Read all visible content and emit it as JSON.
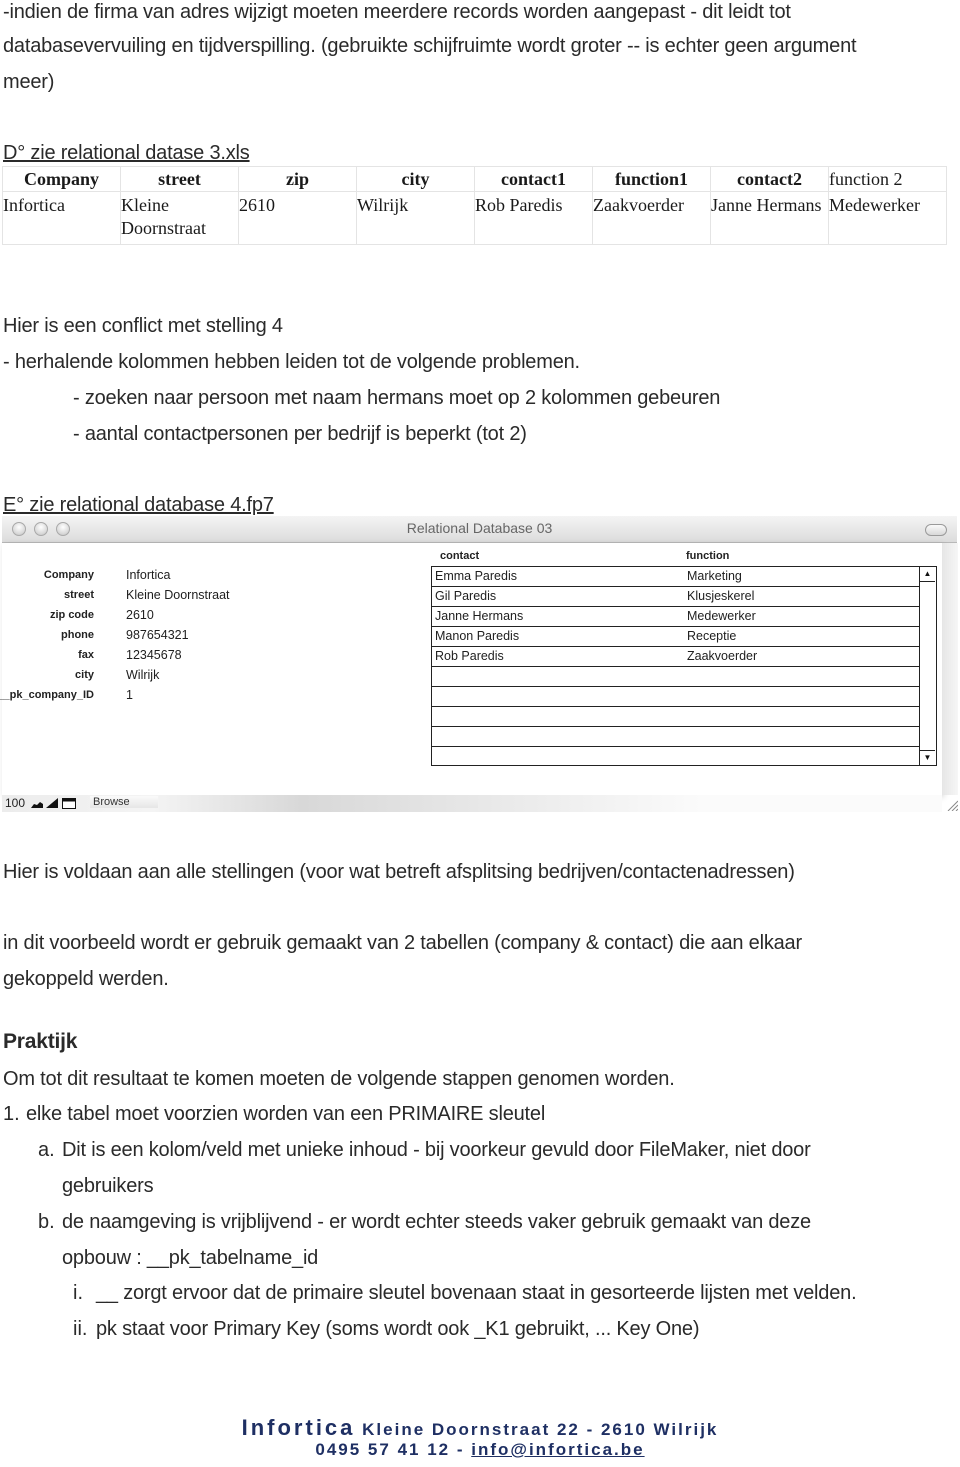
{
  "intro": {
    "line1": "-indien de firma van adres wijzigt moeten meerdere records worden aangepast - dit leidt tot",
    "line2": "databasevervuiling en tijdverspilling. (gebruikte schijfruimte wordt groter -- is echter geen argument",
    "line3": "meer)"
  },
  "section_d": {
    "heading": "D° zie relational datase 3.xls",
    "table": {
      "headers": [
        "Company",
        "street",
        "zip",
        "city",
        "contact1",
        "function1",
        "contact2",
        "function 2"
      ],
      "rows": [
        [
          "Infortica",
          "Kleine Doornstraat",
          "2610",
          "Wilrijk",
          "Rob Paredis",
          "Zaakvoerder",
          "Janne Hermans",
          "Medewerker"
        ]
      ]
    }
  },
  "conflict": {
    "line1": "Hier is een conflict met stelling 4",
    "line2": "- herhalende kolommen hebben leiden tot de volgende problemen.",
    "bullet1": "- zoeken naar persoon met naam hermans moet op 2 kolommen gebeuren",
    "bullet2": "- aantal contactpersonen per bedrijf is beperkt (tot 2)"
  },
  "section_e": {
    "heading": "E° zie relational database 4.fp7"
  },
  "window": {
    "title": "Relational Database 03",
    "fields": [
      {
        "label": "Company",
        "value": "Infortica"
      },
      {
        "label": "street",
        "value": "Kleine Doornstraat"
      },
      {
        "label": "zip code",
        "value": "2610"
      },
      {
        "label": "phone",
        "value": "987654321"
      },
      {
        "label": "fax",
        "value": "12345678"
      },
      {
        "label": "city",
        "value": "Wilrijk"
      },
      {
        "label": "__pk_company_ID",
        "value": "1"
      }
    ],
    "portal": {
      "headers": {
        "contact": "contact",
        "function": "function"
      },
      "rows": [
        {
          "contact": "Emma Paredis",
          "function": "Marketing"
        },
        {
          "contact": "Gil Paredis",
          "function": "Klusjeskerel"
        },
        {
          "contact": "Janne Hermans",
          "function": "Medewerker"
        },
        {
          "contact": "Manon Paredis",
          "function": "Receptie"
        },
        {
          "contact": "Rob Paredis",
          "function": "Zaakvoerder"
        }
      ],
      "scroll_up_icon": "▲",
      "scroll_down_icon": "▼"
    },
    "statusbar": {
      "zoom": "100",
      "mode": "Browse"
    }
  },
  "result": {
    "line1": "Hier is voldaan aan alle stellingen (voor wat betreft afsplitsing bedrijven/contactenadressen)",
    "line2": "in dit voorbeeld wordt er gebruik gemaakt van 2 tabellen (company & contact) die aan elkaar",
    "line3": "gekoppeld werden."
  },
  "praktijk": {
    "heading": "Praktijk",
    "intro": "Om tot dit resultaat te komen moeten de volgende stappen genomen worden.",
    "items": {
      "n1": {
        "marker": "1.",
        "text": "elke tabel moet voorzien worden van een PRIMAIRE sleutel"
      },
      "a": {
        "marker": "a.",
        "text1": "Dit is een kolom/veld met unieke inhoud - bij voorkeur gevuld door FileMaker, niet door",
        "text2": "gebruikers"
      },
      "b": {
        "marker": "b.",
        "text1": "de naamgeving is vrijblijvend - er wordt echter steeds vaker gebruik gemaakt van deze",
        "text2": "opbouw : __pk_tabelname_id"
      },
      "i": {
        "marker": "i.",
        "text": "__ zorgt ervoor dat de primaire sleutel bovenaan staat in gesorteerde lijsten met velden."
      },
      "ii": {
        "marker": "ii.",
        "text": "pk staat voor Primary Key (soms wordt ook _K1 gebruikt, ... Key One)"
      }
    }
  },
  "footer": {
    "brand": "Infortica",
    "address": "Kleine Doornstraat 22 - 2610 Wilrijk",
    "phone": "0495 57 41 12 -",
    "email": "info@infortica.be"
  }
}
